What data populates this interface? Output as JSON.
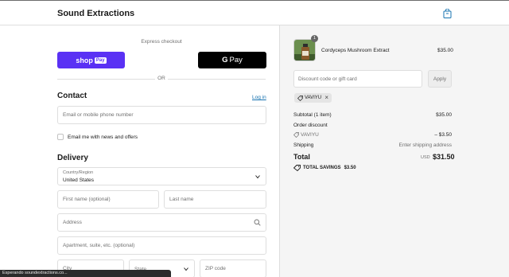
{
  "header": {
    "brand": "Sound Extractions",
    "cart_icon": "shopping-bag-icon"
  },
  "express": {
    "label": "Express checkout",
    "shoppay_label": "shop",
    "shoppay_pill": "Pay",
    "gpay_label": "Pay",
    "gpay_letter": "G",
    "or_text": "OR"
  },
  "contact": {
    "title": "Contact",
    "login_link": "Log in",
    "email_placeholder": "Email or mobile phone number",
    "newsletter_label": "Email me with news and offers"
  },
  "delivery": {
    "title": "Delivery",
    "country_label": "Country/Region",
    "country_value": "United States",
    "first_name_placeholder": "First name (optional)",
    "last_name_placeholder": "Last name",
    "address_placeholder": "Address",
    "apartment_placeholder": "Apartment, suite, etc. (optional)",
    "city_placeholder": "City",
    "state_placeholder": "State",
    "zip_placeholder": "ZIP code"
  },
  "status_bar": {
    "text": "Esperando soundextractions.co..."
  },
  "order": {
    "item": {
      "name": "Cordyceps Mushroom Extract",
      "price": "$35.00",
      "quantity": "1"
    },
    "discount_placeholder": "Discount code or gift card",
    "apply_label": "Apply",
    "applied_code": "VAVIYU",
    "subtotal_label": "Subtotal (1 item)",
    "subtotal_value": "$35.00",
    "order_discount_label": "Order discount",
    "discount_code": "VAVIYU",
    "discount_value": "– $3.50",
    "shipping_label": "Shipping",
    "shipping_value": "Enter shipping address",
    "total_label": "Total",
    "total_currency": "USD",
    "total_value": "$31.50",
    "savings_label": "TOTAL SAVINGS",
    "savings_value": "$3.50"
  },
  "colors": {
    "shoppay": "#5a31f4",
    "link": "#1773b0",
    "panel_bg": "#f5f5f5"
  }
}
